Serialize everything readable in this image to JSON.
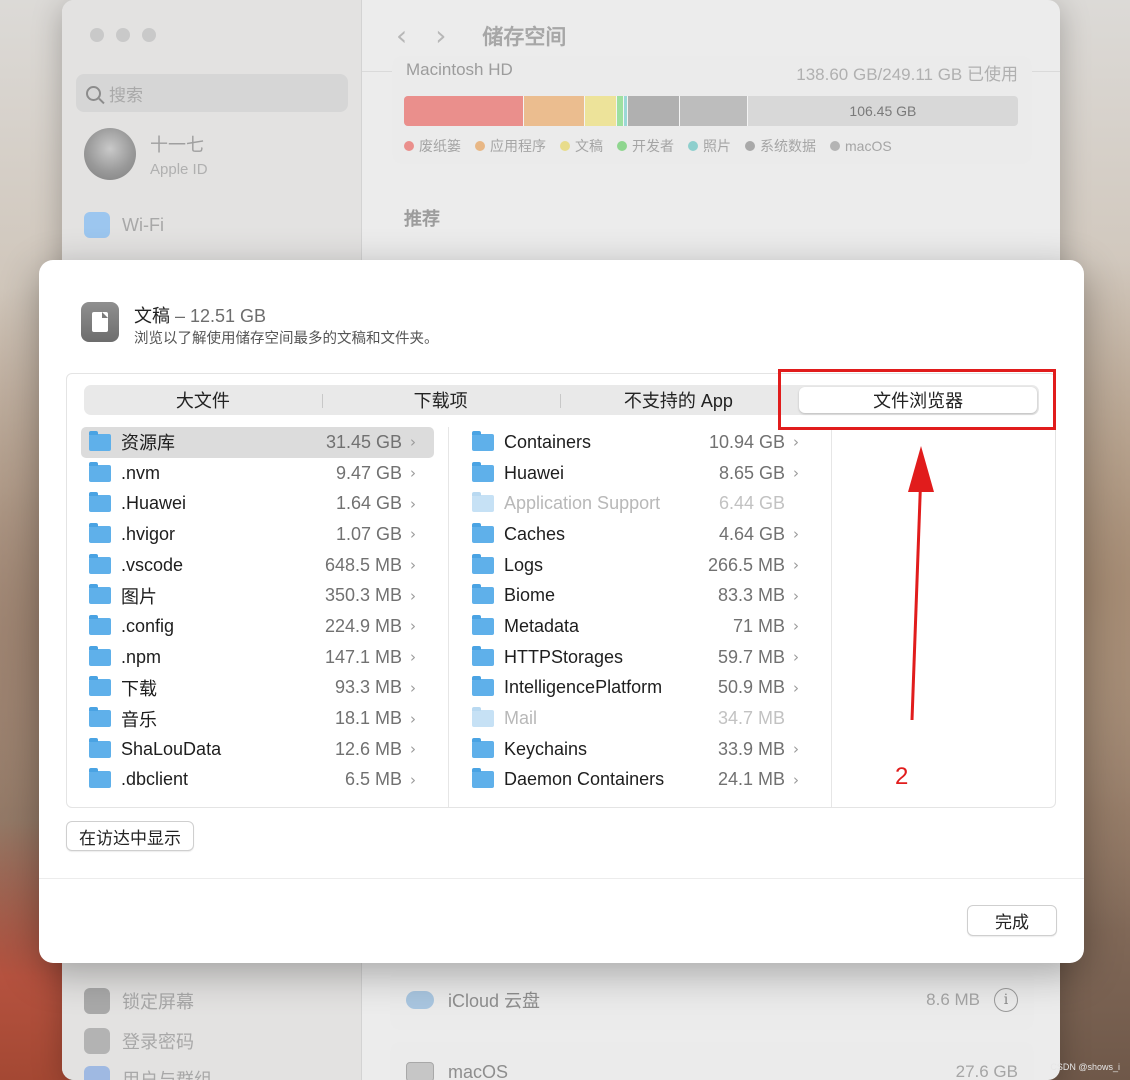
{
  "background_window": {
    "title": "储存空间",
    "search_placeholder": "搜索",
    "account_name": "十一七",
    "account_sub": "Apple ID",
    "sidebar_items": [
      {
        "label": "Wi-Fi",
        "color": "#5ca8ee"
      },
      {
        "label": "锁定屏幕",
        "color": "#7c7c7c"
      },
      {
        "label": "登录密码",
        "color": "#8a8a8a"
      },
      {
        "label": "用户与群组",
        "color": "#5d8fd8"
      }
    ],
    "disk_name": "Macintosh HD",
    "disk_usage": "138.60 GB/249.11 GB 已使用",
    "free_label": "106.45 GB",
    "storage_segments": [
      {
        "name": "废纸篓",
        "color": "#ea8f8c",
        "fraction": 0.195
      },
      {
        "name": "应用程序",
        "color": "#ebbd8f",
        "fraction": 0.1
      },
      {
        "name": "文稿",
        "color": "#ede39a",
        "fraction": 0.052
      },
      {
        "name": "开发者",
        "color": "#9ee0a0",
        "fraction": 0.012
      },
      {
        "name": "照片",
        "color": "#9bd8d6",
        "fraction": 0.006
      },
      {
        "name": "系统数据",
        "color": "#b0b0b0",
        "fraction": 0.085
      },
      {
        "name": "macOS",
        "color": "#bdbdbd",
        "fraction": 0.11
      }
    ],
    "legend": [
      {
        "label": "废纸篓",
        "color": "#ea8f8c"
      },
      {
        "label": "应用程序",
        "color": "#e8b785"
      },
      {
        "label": "文稿",
        "color": "#e8dc8c"
      },
      {
        "label": "开发者",
        "color": "#8fd68f"
      },
      {
        "label": "照片",
        "color": "#8ecfcd"
      },
      {
        "label": "系统数据",
        "color": "#a9a9a9"
      },
      {
        "label": "macOS",
        "color": "#b4b4b4"
      }
    ],
    "recommend_title": "推荐",
    "lower_items": [
      {
        "label": "iCloud 云盘",
        "size": "8.6 MB"
      },
      {
        "label": "macOS",
        "size": "27.6 GB"
      }
    ]
  },
  "sheet": {
    "title": "文稿",
    "size": " – 12.51 GB",
    "subtitle": "浏览以了解使用储存空间最多的文稿和文件夹。",
    "tabs": [
      "大文件",
      "下载项",
      "不支持的 App",
      "文件浏览器"
    ],
    "active_tab": 3,
    "column1": [
      {
        "name": "资源库",
        "size": "31.45 GB",
        "dim": false,
        "selected": true
      },
      {
        "name": ".nvm",
        "size": "9.47 GB",
        "dim": false
      },
      {
        "name": ".Huawei",
        "size": "1.64 GB",
        "dim": false
      },
      {
        "name": ".hvigor",
        "size": "1.07 GB",
        "dim": false
      },
      {
        "name": ".vscode",
        "size": "648.5 MB",
        "dim": false
      },
      {
        "name": "图片",
        "size": "350.3 MB",
        "dim": false
      },
      {
        "name": ".config",
        "size": "224.9 MB",
        "dim": false
      },
      {
        "name": ".npm",
        "size": "147.1 MB",
        "dim": false
      },
      {
        "name": "下载",
        "size": "93.3 MB",
        "dim": false
      },
      {
        "name": "音乐",
        "size": "18.1 MB",
        "dim": false
      },
      {
        "name": "ShaLouData",
        "size": "12.6 MB",
        "dim": false
      },
      {
        "name": ".dbclient",
        "size": "6.5 MB",
        "dim": false
      }
    ],
    "column2": [
      {
        "name": "Containers",
        "size": "10.94 GB",
        "dim": false
      },
      {
        "name": "Huawei",
        "size": "8.65 GB",
        "dim": false
      },
      {
        "name": "Application Support",
        "size": "6.44 GB",
        "dim": true
      },
      {
        "name": "Caches",
        "size": "4.64 GB",
        "dim": false
      },
      {
        "name": "Logs",
        "size": "266.5 MB",
        "dim": false
      },
      {
        "name": "Biome",
        "size": "83.3 MB",
        "dim": false
      },
      {
        "name": "Metadata",
        "size": "71 MB",
        "dim": false
      },
      {
        "name": "HTTPStorages",
        "size": "59.7 MB",
        "dim": false
      },
      {
        "name": "IntelligencePlatform",
        "size": "50.9 MB",
        "dim": false
      },
      {
        "name": "Mail",
        "size": "34.7 MB",
        "dim": true
      },
      {
        "name": "Keychains",
        "size": "33.9 MB",
        "dim": false
      },
      {
        "name": "Daemon Containers",
        "size": "24.1 MB",
        "dim": false
      }
    ],
    "finder_button": "在访达中显示",
    "done_button": "完成"
  },
  "annotation": {
    "number": "2",
    "color": "#e11c1c"
  },
  "watermark": "CSDN @shows_i"
}
